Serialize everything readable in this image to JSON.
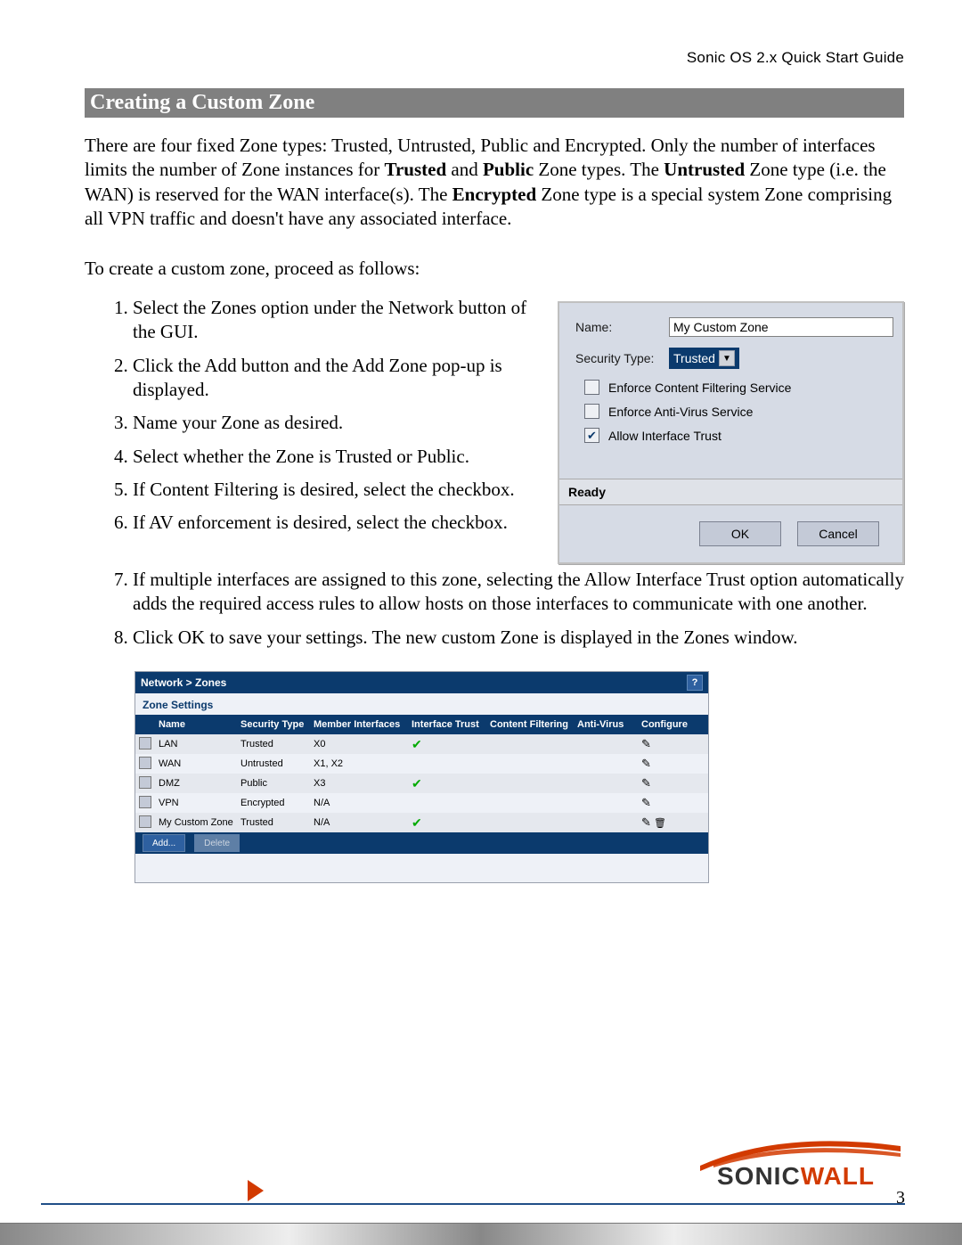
{
  "header": {
    "doc_title": "Sonic OS 2.x Quick Start Guide"
  },
  "section_title": "Creating a Custom Zone",
  "intro_parts": {
    "a": "There are four fixed Zone types: Trusted, Untrusted, Public and Encrypted. Only the number of interfaces limits the number of Zone instances for ",
    "b": "Trusted",
    "c": " and ",
    "d": "Public",
    "e": " Zone types. The ",
    "f": "Untrusted",
    "g": " Zone type (i.e. the WAN) is reserved for the WAN interface(s). The ",
    "h": "Encrypted",
    "i": " Zone type is a special system Zone comprising all VPN traffic and doesn't have any associated interface."
  },
  "proceed_text": "To create a custom zone, proceed as follows:",
  "steps": [
    "Select the Zones option under the Network button of the GUI.",
    "Click the Add button and the Add Zone pop-up is displayed.",
    "Name your Zone as desired.",
    "Select whether the Zone is Trusted or Public.",
    "If Content Filtering is desired, select the checkbox.",
    "If AV enforcement is desired, select the checkbox.",
    "If multiple interfaces are assigned to this zone, selecting the Allow Interface Trust option automatically adds the required access rules to allow hosts on those interfaces to communicate with one another.",
    "Click OK to save your settings. The new custom Zone is displayed in the Zones window."
  ],
  "popup": {
    "name_label": "Name:",
    "name_value": "My Custom Zone",
    "sectype_label": "Security Type:",
    "sectype_value": "Trusted",
    "opt_cfs": "Enforce Content Filtering Service",
    "opt_av": "Enforce Anti-Virus Service",
    "opt_trust": "Allow Interface Trust",
    "status": "Ready",
    "btn_ok": "OK",
    "btn_cancel": "Cancel"
  },
  "zones_table": {
    "breadcrumb": "Network > Zones",
    "section_label": "Zone Settings",
    "help_icon": "?",
    "columns": [
      "Name",
      "Security Type",
      "Member Interfaces",
      "Interface Trust",
      "Content Filtering",
      "Anti-Virus",
      "Configure"
    ],
    "rows": [
      {
        "name": "LAN",
        "sec": "Trusted",
        "mem": "X0",
        "trust": true,
        "cf": false,
        "av": false,
        "del": false
      },
      {
        "name": "WAN",
        "sec": "Untrusted",
        "mem": "X1, X2",
        "trust": false,
        "cf": false,
        "av": false,
        "del": false
      },
      {
        "name": "DMZ",
        "sec": "Public",
        "mem": "X3",
        "trust": true,
        "cf": false,
        "av": false,
        "del": false
      },
      {
        "name": "VPN",
        "sec": "Encrypted",
        "mem": "N/A",
        "trust": false,
        "cf": false,
        "av": false,
        "del": false
      },
      {
        "name": "My Custom Zone",
        "sec": "Trusted",
        "mem": "N/A",
        "trust": true,
        "cf": false,
        "av": false,
        "del": true
      }
    ],
    "btn_add": "Add...",
    "btn_delete": "Delete"
  },
  "logo": {
    "part1": "SONIC",
    "part2": "WALL"
  },
  "page_number": "3"
}
